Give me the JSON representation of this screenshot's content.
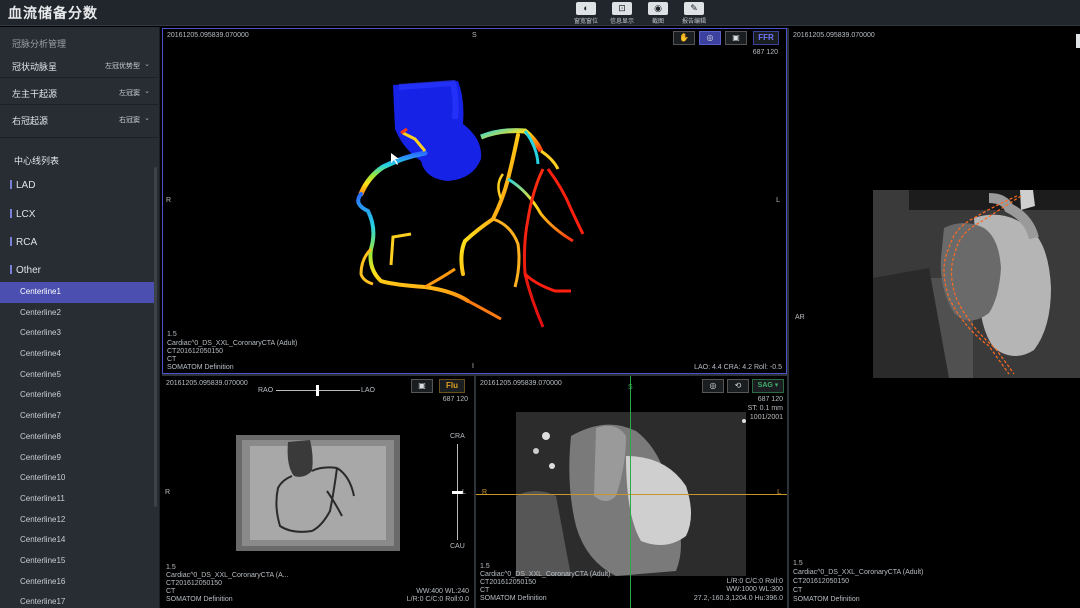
{
  "app": {
    "title": "血流储备分数"
  },
  "toolbar": [
    {
      "label": "窗宽窗位",
      "icon": "contrast-icon",
      "glyph": "◐"
    },
    {
      "label": "信息显示",
      "icon": "info-display-icon",
      "glyph": "⊡"
    },
    {
      "label": "截图",
      "icon": "camera-icon",
      "glyph": "◉"
    },
    {
      "label": "报告编辑",
      "icon": "report-edit-icon",
      "glyph": "✎"
    }
  ],
  "sidebar": {
    "header": "冠脉分析管理",
    "settings": [
      {
        "label": "冠状动脉呈",
        "value": "左冠优势型"
      },
      {
        "label": "左主干起源",
        "value": "左冠窦"
      },
      {
        "label": "右冠起源",
        "value": "右冠窦"
      }
    ],
    "centerline_title": "中心线列表",
    "groups": [
      "LAD",
      "LCX",
      "RCA",
      "Other"
    ],
    "centerlines": [
      "Centerline1",
      "Centerline2",
      "Centerline3",
      "Centerline4",
      "Centerline5",
      "Centerline6",
      "Centerline7",
      "Centerline8",
      "Centerline9",
      "Centerline10",
      "Centerline11",
      "Centerline12",
      "Centerline14",
      "Centerline15",
      "Centerline16",
      "Centerline17"
    ],
    "active_centerline": "Centerline1"
  },
  "vp_main": {
    "study": "20161205.095839.070000",
    "orient_top": "S",
    "orient_left": "R",
    "orient_right": "L",
    "orient_bottom": "I",
    "tag": "FFR",
    "dims": "687 120",
    "slice": "1.5",
    "protocol": "Cardiac^0_DS_XXL_CoronaryCTA (Adult)",
    "ct_id": "CT201612050150",
    "modality": "CT",
    "scanner": "SOMATOM Definition",
    "angles": "LAO: 4.4   CRA: 4.2   Roll: -0.5"
  },
  "vp_right": {
    "study": "20161205.095839.070000",
    "orient": "AR",
    "slice": "1.5",
    "protocol": "Cardiac^0_DS_XXL_CoronaryCTA (Adult)",
    "ct_id": "CT201612050150",
    "modality": "CT",
    "scanner": "SOMATOM Definition"
  },
  "vp_flu": {
    "study": "20161205.095839.070000",
    "rao": "RAO",
    "lao": "LAO",
    "tag": "Flu",
    "dims": "687 120",
    "cra": "CRA",
    "cau": "CAU",
    "orient_left": "R",
    "orient_right": "L",
    "slice": "1.5",
    "protocol": "Cardiac^0_DS_XXL_CoronaryCTA (A...",
    "ct_id": "CT201612050150",
    "modality": "CT",
    "scanner": "SOMATOM Definition",
    "wwwl": "WW:400 WL:240",
    "rc": "L/R:0   C/C:0   Roll:0.0"
  },
  "vp_sag": {
    "study": "20161205.095839.070000",
    "tag": "SAG",
    "orient_top": "S",
    "orient_left": "R",
    "orient_right": "L",
    "dims": "687 120",
    "st": "ST:   0.1   mm",
    "frame": "1001/2001",
    "slice": "1.5",
    "protocol": "Cardiac^0_DS_XXL_CoronaryCTA (Adult)",
    "ct_id": "CT201612050150",
    "modality": "CT",
    "scanner": "SOMATOM Definition",
    "rc": "L/R:0   C/C:0   Roll:0",
    "wwwl": "WW:1000  WL:300",
    "coord": "27.2,-160.3,1204.0 Hu:396.0"
  },
  "colors": {
    "accent": "#4a4fb0",
    "ffr_tag": "#6f76ff",
    "flu_tag": "#e0a020",
    "sag_tag": "#3fae6a",
    "crosshair_h": "#c8962a",
    "crosshair_v": "#2ea84a"
  }
}
